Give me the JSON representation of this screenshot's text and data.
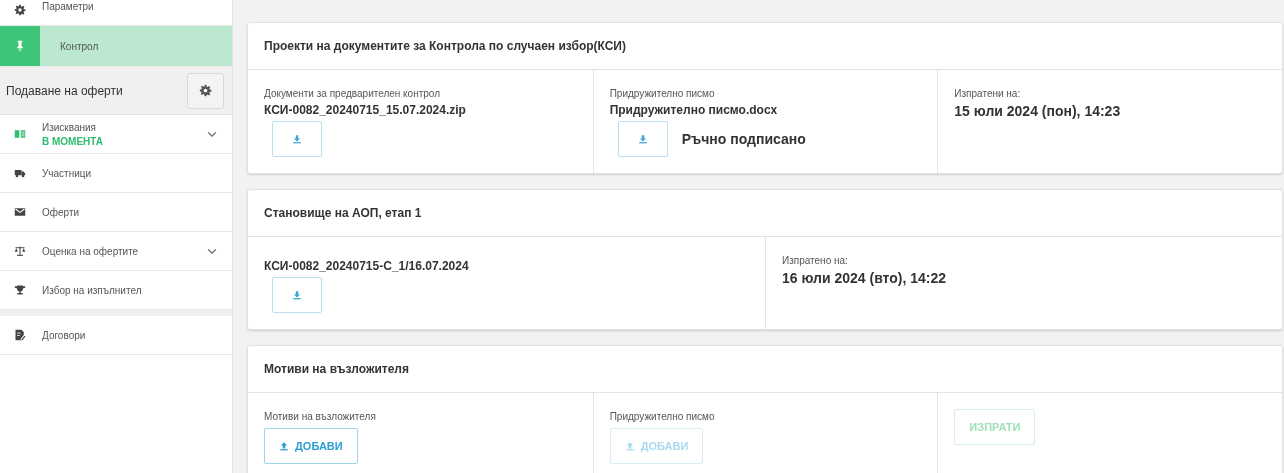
{
  "sidebar": {
    "top_items": [
      {
        "label": "Параметри",
        "selected": false
      },
      {
        "label": "Контрол",
        "selected": true
      }
    ],
    "section": {
      "title": "Подаване на оферти",
      "items": [
        {
          "label": "Изисквания",
          "status": "В МОМЕНТА",
          "kind": "group",
          "selected": false
        },
        {
          "label": "Участници",
          "kind": "link",
          "selected": false
        },
        {
          "label": "Оферти",
          "kind": "link",
          "selected": false
        },
        {
          "label": "Оценка на офертите",
          "kind": "group",
          "selected": false
        },
        {
          "label": "Избор на изпълнител",
          "kind": "link",
          "selected": false
        }
      ]
    },
    "bottom_items": [
      {
        "label": "Договори",
        "selected": false
      }
    ]
  },
  "cards": [
    {
      "title": "Проекти на документите за Контрола по случаен избор(КСИ)",
      "columns": [
        {
          "kind": "file",
          "label": "Документи за предварителен контрол",
          "filename": "КСИ-0082_20240715_15.07.2024.zip"
        },
        {
          "kind": "file",
          "label": "Придружително писмо",
          "filename": "Придружително писмо.docx",
          "note": "Ръчно подписано"
        },
        {
          "kind": "sent",
          "label": "Изпратени на:",
          "date": "15 юли 2024 (пон), 14:23"
        }
      ]
    },
    {
      "title": "Становище на АОП, етап 1",
      "columns": [
        {
          "kind": "file",
          "filename": "КСИ-0082_20240715-С_1/16.07.2024"
        },
        {
          "kind": "sent",
          "label": "Изпратено на:",
          "date": "16 юли 2024 (вто), 14:22"
        }
      ]
    },
    {
      "title": "Мотиви на възложителя",
      "columns": [
        {
          "kind": "upload",
          "label": "Мотиви на възложителя",
          "button": {
            "label": "ДОБАВИ",
            "disabled": false
          }
        },
        {
          "kind": "upload",
          "label": "Придружително писмо",
          "button": {
            "label": "ДОБАВИ",
            "disabled": true
          }
        },
        {
          "kind": "action",
          "button": {
            "label": "ИЗПРАТИ",
            "disabled": true
          }
        }
      ]
    }
  ]
}
